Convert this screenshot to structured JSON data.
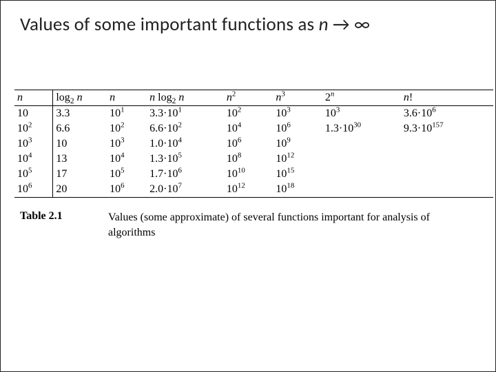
{
  "title": {
    "prefix": "Values of some important functions as ",
    "var": "n",
    "arrow": " → ",
    "inf": "∞"
  },
  "chart_data": {
    "type": "table",
    "title": "Values (some approximate) of several functions important for analysis of algorithms",
    "columns": [
      "n",
      "log2 n",
      "n",
      "n log2 n",
      "n^2",
      "n^3",
      "2^n",
      "n!"
    ],
    "n_values": [
      10,
      100,
      1000,
      10000,
      100000,
      1000000
    ],
    "rows": [
      {
        "n": "10",
        "log2n": "3.3",
        "n_col": "10^1",
        "nlog2n": "3.3·10^1",
        "n2": "10^2",
        "n3": "10^3",
        "two_n": "10^3",
        "nfact": "3.6·10^6"
      },
      {
        "n": "10^2",
        "log2n": "6.6",
        "n_col": "10^2",
        "nlog2n": "6.6·10^2",
        "n2": "10^4",
        "n3": "10^6",
        "two_n": "1.3·10^30",
        "nfact": "9.3·10^157"
      },
      {
        "n": "10^3",
        "log2n": "10",
        "n_col": "10^3",
        "nlog2n": "1.0·10^4",
        "n2": "10^6",
        "n3": "10^9",
        "two_n": "",
        "nfact": ""
      },
      {
        "n": "10^4",
        "log2n": "13",
        "n_col": "10^4",
        "nlog2n": "1.3·10^5",
        "n2": "10^8",
        "n3": "10^12",
        "two_n": "",
        "nfact": ""
      },
      {
        "n": "10^5",
        "log2n": "17",
        "n_col": "10^5",
        "nlog2n": "1.7·10^6",
        "n2": "10^10",
        "n3": "10^15",
        "two_n": "",
        "nfact": ""
      },
      {
        "n": "10^6",
        "log2n": "20",
        "n_col": "10^6",
        "nlog2n": "2.0·10^7",
        "n2": "10^12",
        "n3": "10^18",
        "two_n": "",
        "nfact": ""
      }
    ]
  },
  "caption": {
    "label": "Table 2.1",
    "text": "Values (some approximate) of several functions important for analysis of algorithms"
  }
}
